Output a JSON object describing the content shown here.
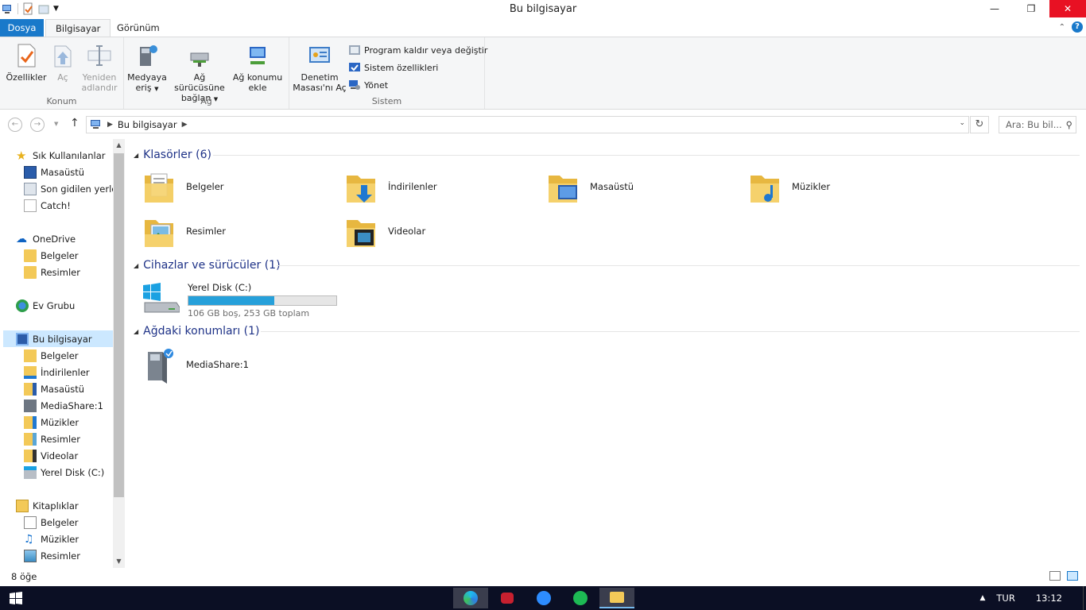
{
  "window": {
    "title": "Bu bilgisayar"
  },
  "tabs": {
    "file": "Dosya",
    "computer": "Bilgisayar",
    "view": "Görünüm"
  },
  "ribbon": {
    "konum": {
      "label": "Konum",
      "properties": "Özellikler",
      "open": "Aç",
      "rename_line1": "Yeniden",
      "rename_line2": "adlandır"
    },
    "ag": {
      "label": "Ağ",
      "media_line1": "Medyaya",
      "media_line2": "eriş",
      "map_line1": "Ağ sürücüsüne",
      "map_line2": "bağlan",
      "addloc_line1": "Ağ konumu",
      "addloc_line2": "ekle"
    },
    "sistem": {
      "label": "Sistem",
      "control_line1": "Denetim",
      "control_line2": "Masası'nı Aç",
      "uninstall": "Program kaldır veya değiştir",
      "sysprops": "Sistem özellikleri",
      "manage": "Yönet"
    }
  },
  "address": {
    "crumb": "Bu bilgisayar",
    "search_placeholder": "Ara: Bu bil..."
  },
  "nav": {
    "quick_access": "Sık Kullanılanlar",
    "qa_items": [
      "Masaüstü",
      "Son gidilen yerler",
      "Catch!"
    ],
    "onedrive": "OneDrive",
    "od_items": [
      "Belgeler",
      "Resimler"
    ],
    "homegroup": "Ev Grubu",
    "thispc": "Bu bilgisayar",
    "pc_items": [
      "Belgeler",
      "İndirilenler",
      "Masaüstü",
      "MediaShare:1",
      "Müzikler",
      "Resimler",
      "Videolar",
      "Yerel Disk (C:)"
    ],
    "libraries": "Kitaplıklar",
    "lib_items": [
      "Belgeler",
      "Müzikler",
      "Resimler"
    ]
  },
  "content": {
    "folders_title": "Klasörler (6)",
    "folders": [
      "Belgeler",
      "İndirilenler",
      "Masaüstü",
      "Müzikler",
      "Resimler",
      "Videolar"
    ],
    "devices_title": "Cihazlar ve sürücüler (1)",
    "drive": {
      "name": "Yerel Disk (C:)",
      "free": "106 GB boş, 253 GB toplam",
      "used_fraction": 0.58
    },
    "network_title": "Ağdaki konumları (1)",
    "network_item": "MediaShare:1"
  },
  "status": {
    "count": "8 öğe"
  },
  "taskbar": {
    "lang": "TUR",
    "time": "13:12"
  },
  "colors": {
    "accent": "#1979ca",
    "selection": "#cce8ff",
    "bar_fill": "#26a0da",
    "folder": "#f3c958"
  }
}
